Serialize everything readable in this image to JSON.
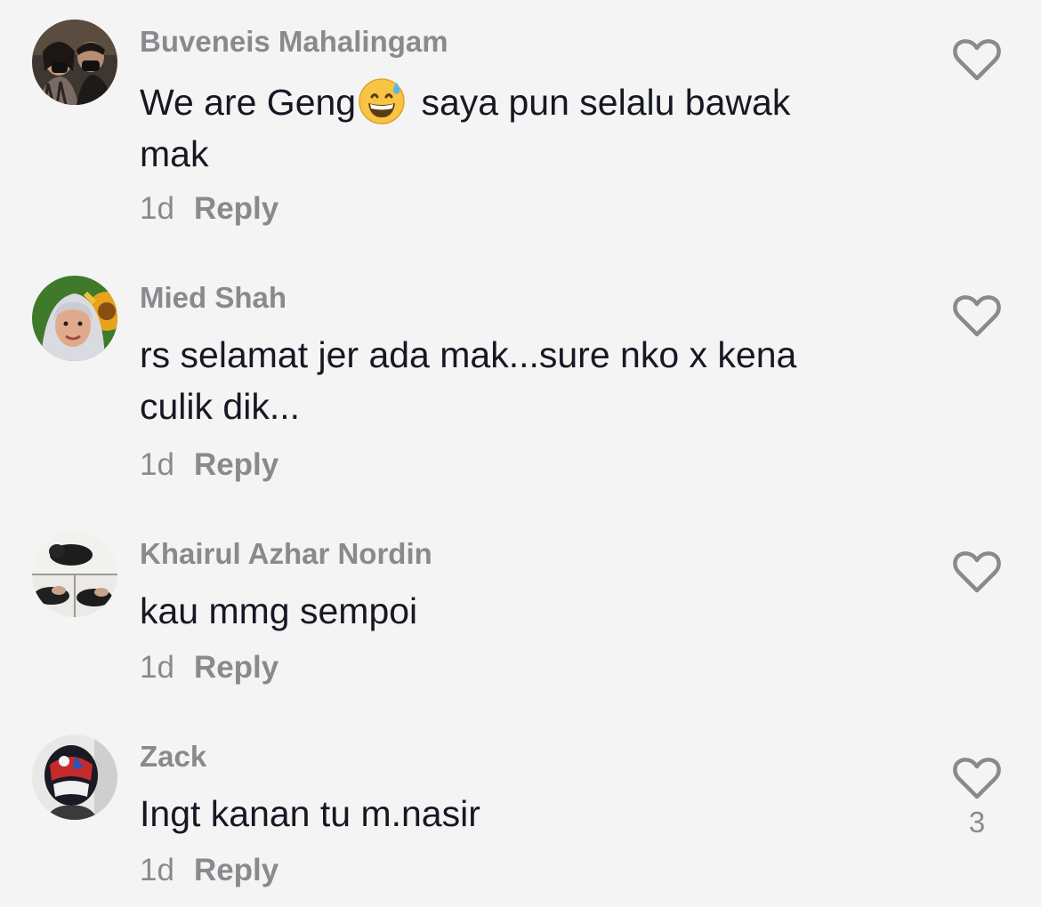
{
  "comments": [
    {
      "username": "Buveneis Mahalingam",
      "text_before": "We are Geng",
      "emoji": "grinning-sweat-emoji",
      "text_after": " saya pun selalu bawak mak",
      "time": "1d",
      "reply_label": "Reply",
      "like_count": ""
    },
    {
      "username": "Mied Shah",
      "text": "rs selamat jer ada mak...sure nko x kena culik dik...",
      "time": "1d",
      "reply_label": "Reply",
      "like_count": ""
    },
    {
      "username": "Khairul Azhar Nordin",
      "text": "kau mmg sempoi",
      "time": "1d",
      "reply_label": "Reply",
      "like_count": ""
    },
    {
      "username": "Zack",
      "text": "Ingt kanan tu m.nasir",
      "time": "1d",
      "reply_label": "Reply",
      "like_count": "3"
    }
  ],
  "icons": {
    "like": "heart-outline-icon"
  },
  "colors": {
    "background": "#f4f4f4",
    "username": "#8a8a8e",
    "text": "#161823",
    "heart": "#8a8a8e"
  }
}
